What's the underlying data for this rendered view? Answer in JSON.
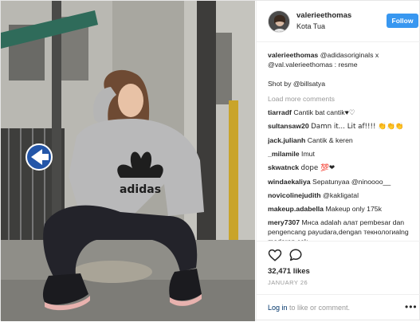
{
  "header": {
    "username": "valerieethomas",
    "location": "Kota Tua",
    "follow_label": "Follow"
  },
  "caption": {
    "username": "valerieethomas",
    "text": "@adidasoriginals x @val.valerieethomas : resme",
    "shot_by": "Shot by @billsatya"
  },
  "load_more": "Load more comments",
  "comments": [
    {
      "user": "tiarradf",
      "text": "Cantik bat cantik♥♡"
    },
    {
      "user": "sultansaw20",
      "text": "Damn it... Lit af!!!! 👏👏👏"
    },
    {
      "user": "jack.julianh",
      "text": "Cantik & keren"
    },
    {
      "user": "_milamile",
      "text": "Imut"
    },
    {
      "user": "skwatnck",
      "text": "dope 💯❤"
    },
    {
      "user": "windaekaliya",
      "text": "Sepatunyaa @ninoooo__"
    },
    {
      "user": "novicolinejudith",
      "text": "@kakligatal"
    },
    {
      "user": "makeup.adabella",
      "text": "Makeup only 175k"
    },
    {
      "user": "mery7307",
      "text": "Мнса adalah алат pembesar dan pengencang payudara,dengan текнологиalng moderen cek instagram@consultant_payudara_healty"
    }
  ],
  "actions": {
    "like_icon": "heart-outline-icon",
    "comment_icon": "speech-bubble-icon",
    "likes": "32,471 likes",
    "date": "JANUARY 26"
  },
  "login": {
    "link": "Log in",
    "text": " to like or comment.",
    "more": "•••"
  },
  "photo": {
    "logo_text": "adidas"
  },
  "colors": {
    "follow": "#3897f0",
    "muted": "#999999",
    "link": "#003569"
  }
}
